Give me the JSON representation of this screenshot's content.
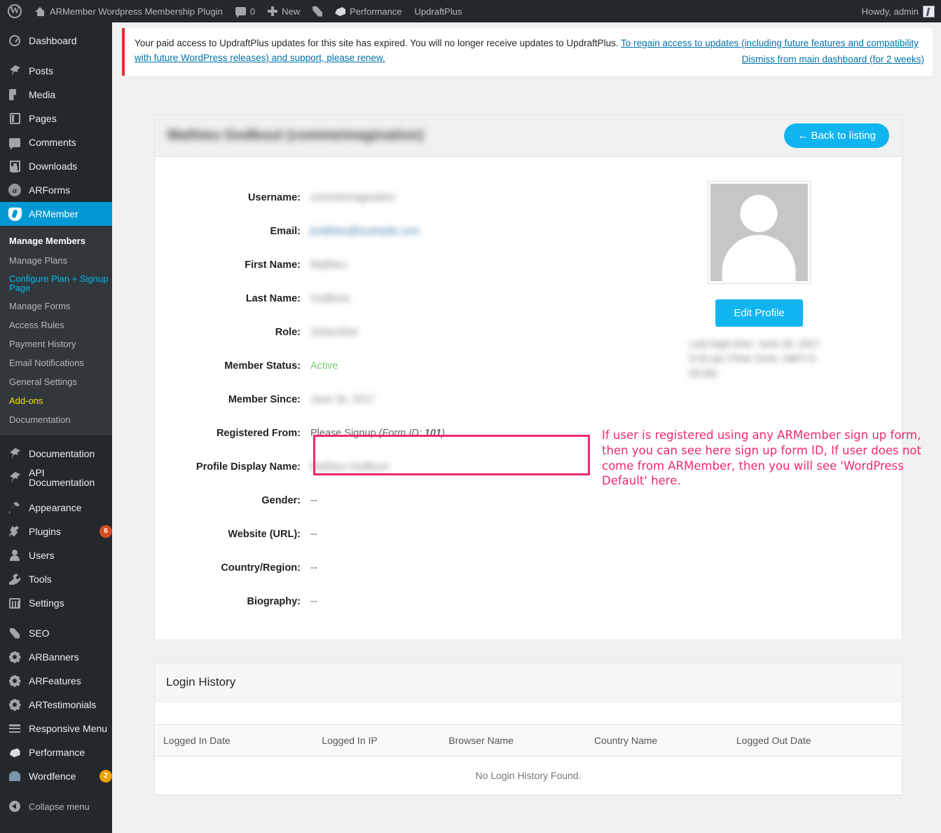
{
  "adminbar": {
    "wp_logo": "W",
    "site_title": "ARMember Wordpress Membership Plugin",
    "comments_count": "0",
    "new_label": "New",
    "performance_label": "Performance",
    "updraftplus_label": "UpdraftPlus",
    "howdy": "Howdy, admin"
  },
  "notice": {
    "text_before": "Your paid access to UpdraftPlus updates for this site has expired. You will no longer receive updates to UpdraftPlus.",
    "link_text": "To regain access to updates (including future features and compatibility with future WordPress releases) and support, please renew.",
    "dismiss_text": "Dismiss from main dashboard (for 2 weeks)",
    "border_color": "#dc3232"
  },
  "sidebar": {
    "items": [
      {
        "label": "Dashboard",
        "icon": "dashboard-icon"
      },
      {
        "label": "Posts",
        "icon": "pin-icon"
      },
      {
        "label": "Media",
        "icon": "media-icon"
      },
      {
        "label": "Pages",
        "icon": "pages-icon"
      },
      {
        "label": "Comments",
        "icon": "comment-icon"
      },
      {
        "label": "Downloads",
        "icon": "download-icon"
      },
      {
        "label": "ARForms",
        "icon": "arforms-icon"
      },
      {
        "label": "ARMember",
        "icon": "armember-icon"
      }
    ],
    "armember_submenu": [
      {
        "label": "Manage Members",
        "state": "bold"
      },
      {
        "label": "Manage Plans",
        "state": "normal"
      },
      {
        "label": "Configure Plan + Signup Page",
        "state": "current"
      },
      {
        "label": "Manage Forms",
        "state": "normal"
      },
      {
        "label": "Access Rules",
        "state": "normal"
      },
      {
        "label": "Payment History",
        "state": "normal"
      },
      {
        "label": "Email Notifications",
        "state": "normal"
      },
      {
        "label": "General Settings",
        "state": "normal"
      },
      {
        "label": "Add-ons",
        "state": "yellow"
      },
      {
        "label": "Documentation",
        "state": "normal"
      }
    ],
    "items2": [
      {
        "label": "Documentation",
        "icon": "pin-icon"
      },
      {
        "label": "API Documentation",
        "icon": "pin-icon"
      }
    ],
    "items3": [
      {
        "label": "Appearance",
        "icon": "appearance-icon",
        "badge": ""
      },
      {
        "label": "Plugins",
        "icon": "plugin-icon",
        "badge": "6"
      },
      {
        "label": "Users",
        "icon": "user-icon",
        "badge": ""
      },
      {
        "label": "Tools",
        "icon": "tools-icon",
        "badge": ""
      },
      {
        "label": "Settings",
        "icon": "settings-icon",
        "badge": ""
      }
    ],
    "items4": [
      {
        "label": "SEO",
        "icon": "yoast-icon",
        "badge": ""
      },
      {
        "label": "ARBanners",
        "icon": "gear-icon",
        "badge": ""
      },
      {
        "label": "ARFeatures",
        "icon": "gear-icon",
        "badge": ""
      },
      {
        "label": "ARTestimonials",
        "icon": "gear-icon",
        "badge": ""
      },
      {
        "label": "Responsive Menu",
        "icon": "hamburger-icon",
        "badge": ""
      },
      {
        "label": "Performance",
        "icon": "performance-icon",
        "badge": ""
      },
      {
        "label": "Wordfence",
        "icon": "wordfence-icon",
        "badge": "2"
      }
    ],
    "collapse_label": "Collapse menu",
    "active_color": "#0099d5"
  },
  "profile": {
    "title": "Mathieu Godbout (commeimagination)",
    "back_button": "← Back to listing",
    "fields": [
      {
        "label": "Username:",
        "value": "commeimagination",
        "style": "blurred"
      },
      {
        "label": "Email:",
        "value": "jmathieu@example.com",
        "style": "blurred email"
      },
      {
        "label": "First Name:",
        "value": "Mathieu",
        "style": "blurred"
      },
      {
        "label": "Last Name:",
        "value": "Godbout",
        "style": "blurred"
      },
      {
        "label": "Role:",
        "value": "Subscriber",
        "style": "blurred"
      },
      {
        "label": "Member Status:",
        "value": "Active",
        "style": "active"
      },
      {
        "label": "Member Since:",
        "value": "June 26, 2017",
        "style": "blurred"
      }
    ],
    "registered_from": {
      "label": "Registered From:",
      "value": "Please Signup",
      "form_label": "(Form ID:",
      "form_id": "101",
      "form_close": ")"
    },
    "fields2": [
      {
        "label": "Profile Display Name:",
        "value": "Mathieu Godbout",
        "style": "blurred"
      },
      {
        "label": "Gender:",
        "value": "--",
        "style": ""
      },
      {
        "label": "Website (URL):",
        "value": "--",
        "style": ""
      },
      {
        "label": "Country/Region:",
        "value": "--",
        "style": ""
      },
      {
        "label": "Biography:",
        "value": "--",
        "style": ""
      }
    ],
    "edit_profile_button": "Edit Profile",
    "last_login_text": "Last login time: June 26, 2017 9:33 am (Time Zone: GMT+0 00:00)",
    "annotation": "If user is registered using any ARMember sign up form, then you can see here sign up form ID, If user does not come from ARMember, then you will see 'WordPress Default' here.",
    "annotation_color": "#f0296a",
    "button_color": "#10b5f0",
    "active_status_color": "#7cc576"
  },
  "login_history": {
    "title": "Login History",
    "columns": [
      "Logged In Date",
      "Logged In IP",
      "Browser Name",
      "Country Name",
      "Logged Out Date"
    ],
    "empty_message": "No Login History Found."
  }
}
